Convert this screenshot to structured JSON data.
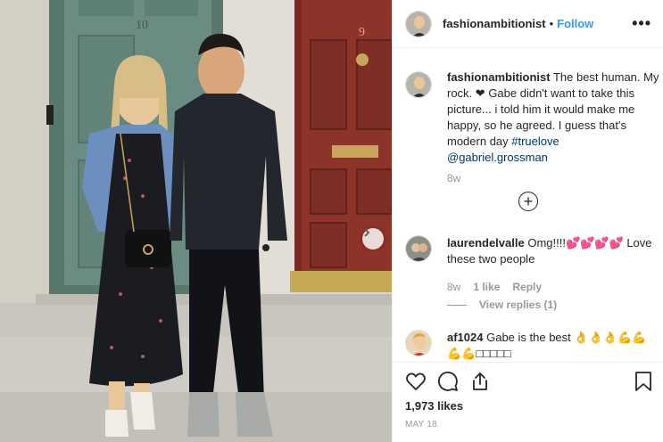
{
  "post": {
    "username": "fashionambitionist",
    "follow_label": "Follow",
    "separator": "•",
    "more_label": "•••",
    "caption": {
      "username": "fashionambitionist",
      "text_1": "The best human. My rock. ",
      "heart": "❤",
      "text_2": " Gabe didn't want to take this picture... i told him it would make me happy, so he agreed. I guess that's modern day ",
      "hashtag": "#truelove",
      "mention": "@gabriel.grossman",
      "time": "8w"
    },
    "load_more_label": "+",
    "comments": [
      {
        "username": "laurendelvalle",
        "text": "Omg!!!!💕💕💕💕 Love these two people",
        "time": "8w",
        "likes": "1 like",
        "reply_label": "Reply",
        "view_replies": "View replies (1)"
      },
      {
        "username": "af1024",
        "text": "Gabe is the best 👌👌👌💪💪💪💪□□□□□"
      }
    ],
    "likes_label": "1,973 likes",
    "date_label": "MAY 18",
    "photo_nav": "next-arrow",
    "door_numbers": {
      "left": "10",
      "right": "9"
    }
  },
  "icons": [
    "heart-icon",
    "comment-icon",
    "share-icon",
    "bookmark-icon",
    "chevron-right-icon",
    "more-icon",
    "plus-circle-icon"
  ],
  "colors": {
    "accent": "#3897f0",
    "text": "#262626",
    "muted": "#999999",
    "link": "#003569"
  }
}
